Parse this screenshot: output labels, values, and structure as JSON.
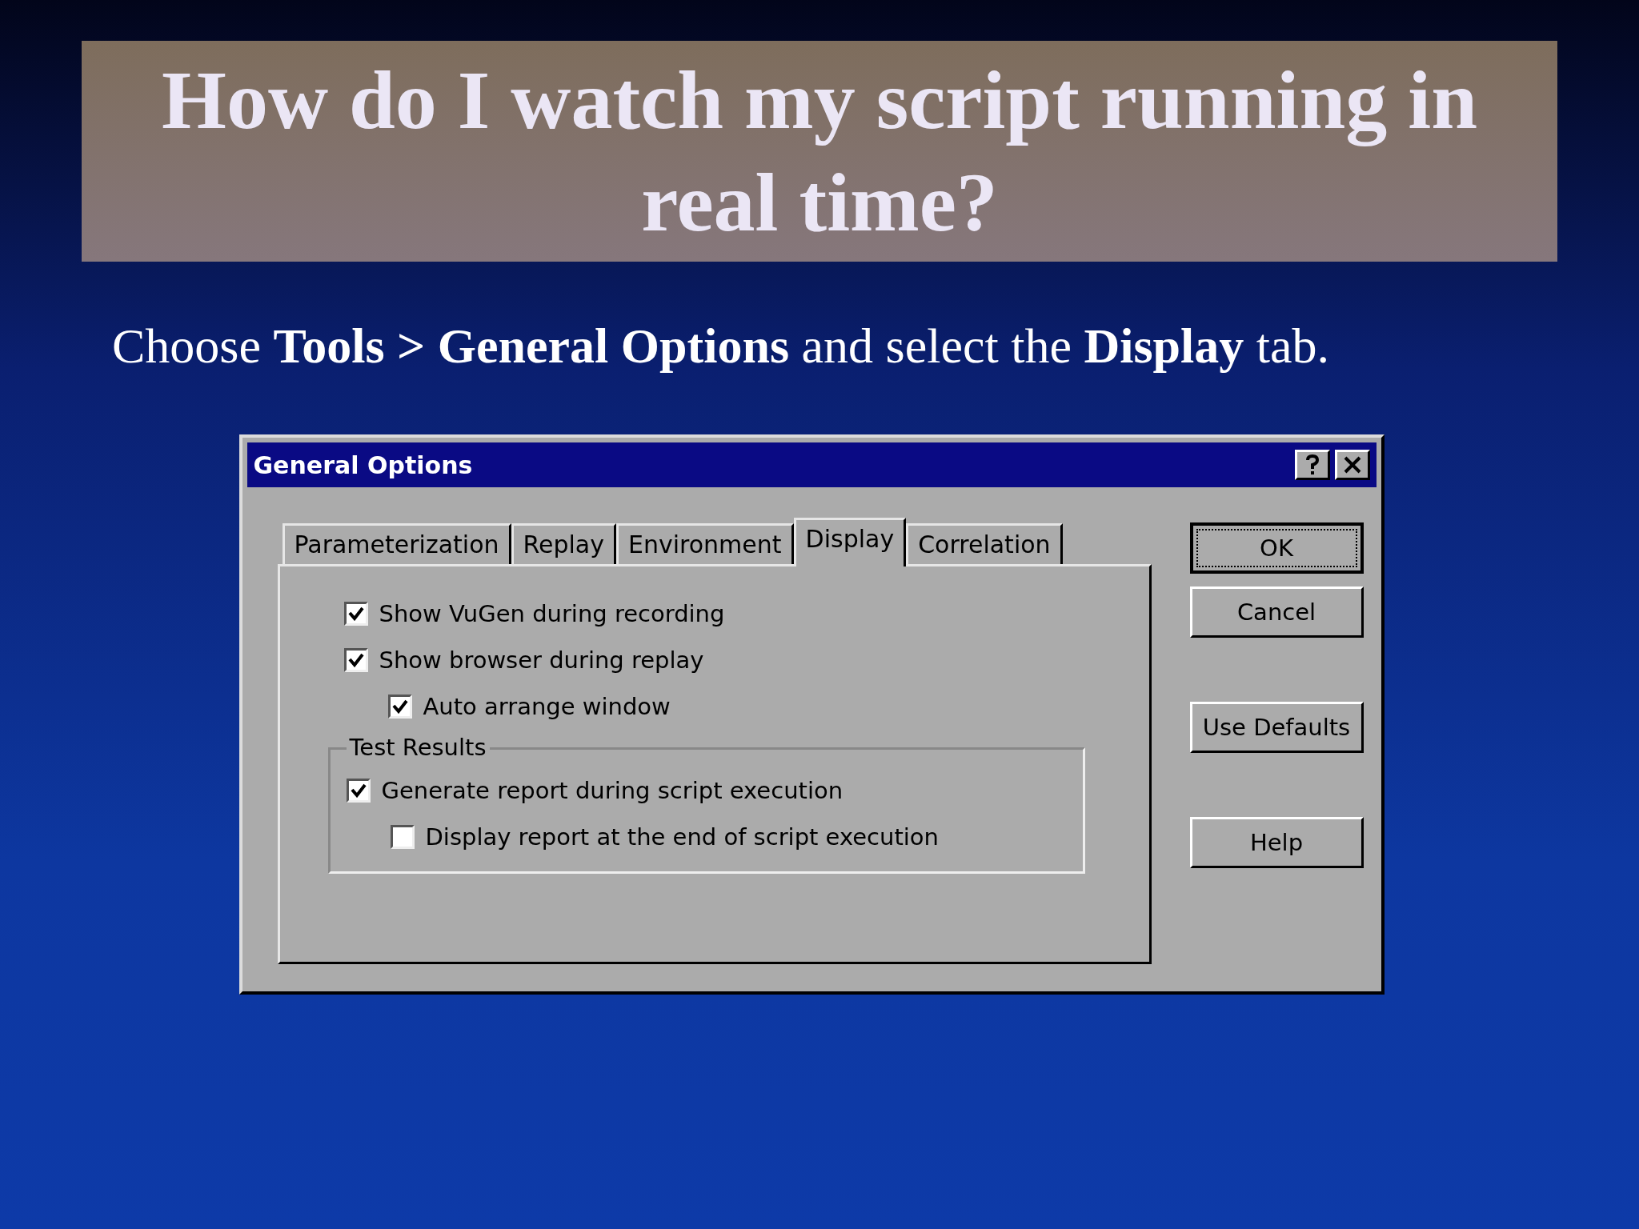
{
  "slide": {
    "title": "How do I watch my script running in real time?",
    "subtitle": "Choose **Tools > General Options** and select the **Display** tab."
  },
  "dialog": {
    "title": "General Options",
    "tabs": [
      {
        "label": "Parameterization",
        "selected": false
      },
      {
        "label": "Replay",
        "selected": false
      },
      {
        "label": "Environment",
        "selected": false
      },
      {
        "label": "Display",
        "selected": true
      },
      {
        "label": "Correlation",
        "selected": false
      }
    ],
    "options": [
      {
        "label": "Show VuGen during recording",
        "checked": true
      },
      {
        "label": "Show browser during replay",
        "checked": true,
        "children": [
          {
            "label": "Auto arrange window",
            "checked": true
          }
        ]
      }
    ],
    "group": {
      "title": "Test Results",
      "options": [
        {
          "label": "Generate report during script execution",
          "checked": true,
          "children": [
            {
              "label": "Display report at the end of script execution",
              "checked": false
            }
          ]
        }
      ]
    },
    "buttons": [
      {
        "label": "OK",
        "default": true
      },
      {
        "label": "Cancel",
        "default": false
      },
      {
        "label": "Use Defaults",
        "default": false
      },
      {
        "label": "Help",
        "default": false
      }
    ]
  }
}
